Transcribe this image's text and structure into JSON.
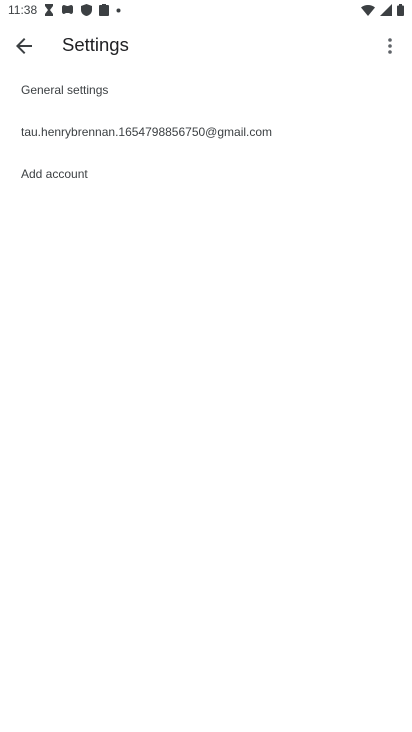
{
  "status_bar": {
    "time": "11:38",
    "left_icons": [
      "hourglass-icon",
      "gamepad-icon",
      "shield-icon",
      "clipboard-icon",
      "dot-icon"
    ],
    "right_icons": [
      "wifi-icon",
      "signal-icon",
      "battery-icon"
    ]
  },
  "app_bar": {
    "back_icon": "arrow-back-icon",
    "title": "Settings",
    "menu_icon": "more-vert-icon"
  },
  "settings_list": {
    "items": [
      {
        "label": "General settings"
      },
      {
        "label": "tau.henrybrennan.1654798856750@gmail.com"
      },
      {
        "label": "Add account"
      }
    ]
  },
  "colors": {
    "background": "#ffffff",
    "text_primary": "#202124",
    "text_secondary": "#3c4043",
    "icon": "#5f6368"
  }
}
